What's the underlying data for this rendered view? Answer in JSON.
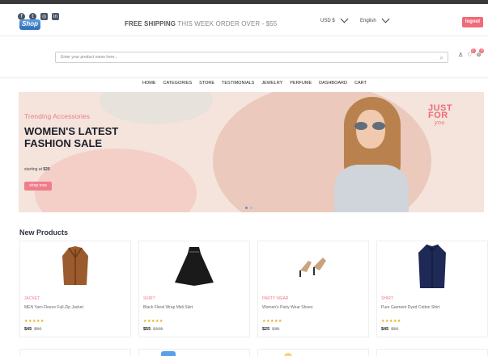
{
  "notice": {
    "social": [
      "f",
      "t",
      "◎",
      "in"
    ],
    "shipping_bold": "FREE SHIPPING",
    "shipping_rest": " THIS WEEK ORDER OVER - $55",
    "currency": "USD $",
    "language": "English",
    "logout": "logout"
  },
  "header": {
    "logo_text": "Shop",
    "search_placeholder": "Enter your product name here...",
    "search_icon": "⌕",
    "user_icon": "♙",
    "wishlist_icon": "♡",
    "cart_icon": "⊚",
    "wishlist_count": "0",
    "cart_count": "0"
  },
  "nav": {
    "items": [
      "HOME",
      "CATEGORIES",
      "STORE",
      "TESTIMONIALS",
      "JEWELRY",
      "PERFUME",
      "DASHBOARD",
      "CART"
    ]
  },
  "hero": {
    "tag": "Trending Accessories",
    "headline": "WOMEN'S LATEST FASHION SALE",
    "starting_prefix": "starting at ",
    "starting_price": "$20",
    "button": "shop now",
    "side_text_1": "JUST",
    "side_text_2": "FOR",
    "side_text_3": "you"
  },
  "products": {
    "title": "New Products",
    "items": [
      {
        "category": "JACKET",
        "name": "MEN Yarn Fleece Full-Zip Jacket",
        "stars": "★★★★★",
        "price": "$45",
        "old_price": "$56"
      },
      {
        "category": "SKIRT",
        "name": "Black Floral Wrap Midi Skirt",
        "stars": "★★★★★",
        "price": "$55",
        "old_price": "$105"
      },
      {
        "category": "PARTY WEAR",
        "name": "Women's Party Wear Shoes",
        "stars": "★★★★★",
        "price": "$25",
        "old_price": "$35"
      },
      {
        "category": "SHIRT",
        "name": "Pure Garment Dyed Cotton Shirt",
        "stars": "★★★★★",
        "price": "$45",
        "old_price": "$56"
      }
    ]
  },
  "colors": {
    "accent": "#f06a78",
    "hero_bg": "#f4e4dc",
    "dark_text": "#1c1f2a"
  }
}
